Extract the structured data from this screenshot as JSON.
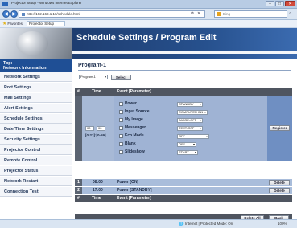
{
  "browser": {
    "window_title": "Projector Setup - Windows Internet Explorer",
    "address": "http://192.168.1.10/schedule.html",
    "search_engine": "Bing",
    "favorites_label": "Favorites",
    "tab_label": "Projector Setup",
    "status_zone": "Internet | Protected Mode: On",
    "zoom": "100%"
  },
  "page": {
    "title": "Schedule Settings / Program Edit"
  },
  "sidebar": {
    "top_label_line1": "Top:",
    "top_label_line2": "Network Information",
    "items": [
      {
        "label": "Network Settings"
      },
      {
        "label": "Port Settings"
      },
      {
        "label": "Mail Settings"
      },
      {
        "label": "Alert Settings"
      },
      {
        "label": "Schedule Settings"
      },
      {
        "label": "Date/Time Settings"
      },
      {
        "label": "Security Settings"
      },
      {
        "label": "Projector Control"
      },
      {
        "label": "Remote Control"
      },
      {
        "label": "Projector Status"
      },
      {
        "label": "Network Restart"
      },
      {
        "label": "Connection Test"
      }
    ]
  },
  "program": {
    "title": "Program-1",
    "select_value": "Program-1",
    "select_button": "Select"
  },
  "table": {
    "col_hash": "#",
    "col_time": "Time",
    "col_event": "Event [Parameter]"
  },
  "new_event": {
    "hour": "00",
    "minute": "00",
    "time_range": "[0-23]:[0-59]",
    "register_button": "Register",
    "rows": [
      {
        "label": "Power",
        "value": "STANDBY"
      },
      {
        "label": "Input Source",
        "value": "COMPUTER IN1"
      },
      {
        "label": "My Image",
        "value": "IMAGE-OFF"
      },
      {
        "label": "Messenger",
        "value": "TEXT-OFF"
      },
      {
        "label": "Eco Mode",
        "value": "OFF"
      },
      {
        "label": "Blank",
        "value": "OFF"
      },
      {
        "label": "Slideshow",
        "value": "START"
      }
    ]
  },
  "events": [
    {
      "num": "1",
      "time": "08:00",
      "event": "Power [ON]",
      "button": "Delete"
    },
    {
      "num": "2",
      "time": "17:00",
      "event": "Power [STANDBY]",
      "button": "Delete"
    }
  ],
  "footer_buttons": {
    "delete_all": "Delete All",
    "back": "Back"
  }
}
